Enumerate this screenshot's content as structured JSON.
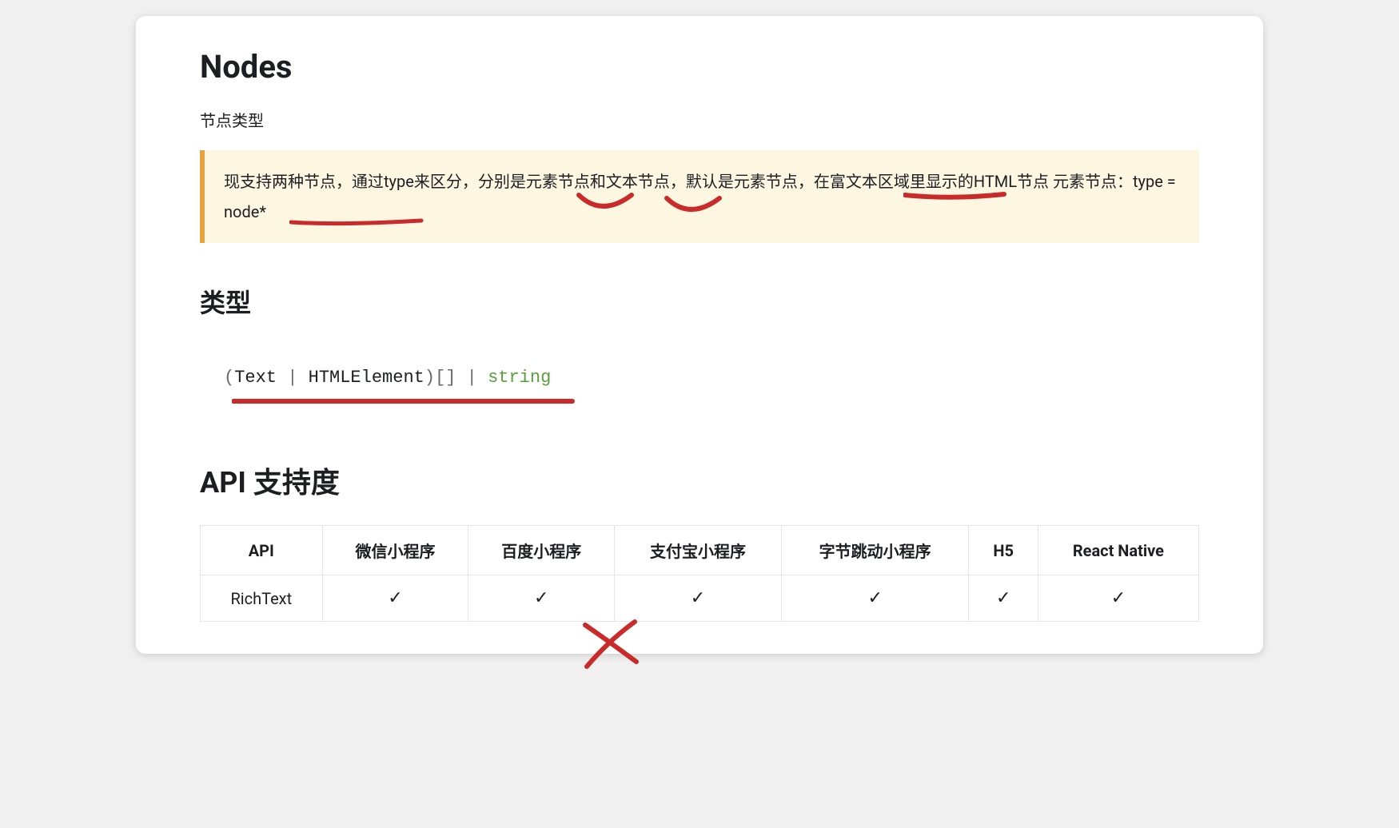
{
  "headings": {
    "nodes": "Nodes",
    "nodeTypeLabel": "节点类型",
    "typeSection": "类型",
    "apiSupport": "API 支持度"
  },
  "blockquote": {
    "text": "现支持两种节点，通过type来区分，分别是元素节点和文本节点，默认是元素节点，在富文本区域里显示的HTML节点 元素节点：type = node*"
  },
  "typeSignature": {
    "openParen": "(",
    "type1": "Text",
    "sep1": " | ",
    "type2": "HTMLElement",
    "closeParen": ")",
    "brackets": "[]",
    "sep2": " | ",
    "string": "string"
  },
  "table": {
    "headers": [
      "API",
      "微信小程序",
      "百度小程序",
      "支付宝小程序",
      "字节跳动小程序",
      "H5",
      "React Native"
    ],
    "rows": [
      {
        "api": "RichText",
        "cells": [
          "✓",
          "✓",
          "✓",
          "✓",
          "✓",
          "✓"
        ]
      }
    ]
  }
}
